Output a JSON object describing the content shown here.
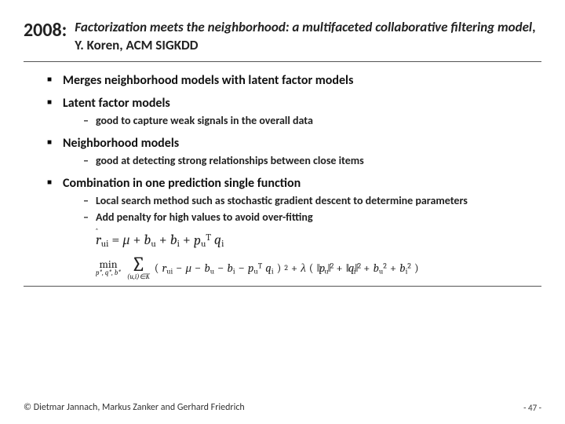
{
  "header": {
    "year": "2008:",
    "title_italic": "Factorization meets the neighborhood: a multifaceted collaborative filtering model",
    "title_rest": ", Y. Koren, ACM SIGKDD"
  },
  "bullets": {
    "b1": "Merges neighborhood models with latent factor models",
    "b2": "Latent factor models",
    "b2_sub1": "good to capture weak signals in the overall data",
    "b3": "Neighborhood models",
    "b3_sub1": "good at detecting strong relationships between close items",
    "b4": "Combination in one prediction single function",
    "b4_sub1": "Local search method such as stochastic gradient descent to determine parameters",
    "b4_sub2": "Add penalty for high values to avoid over-fitting"
  },
  "formula": {
    "lhs_var": "r",
    "lhs_sub": "ui",
    "mu": "μ",
    "plus": "+",
    "eq": "=",
    "bu_b": "b",
    "bu_sub": "u",
    "bi_b": "b",
    "bi_sub": "i",
    "pu_p": "p",
    "pu_sub": "u",
    "pu_sup": "T",
    "qi_q": "q",
    "qi_sub": "i",
    "min": "min",
    "min_sub": "p*, q*, b*",
    "sum_lim": "(u,i)∈K",
    "open_paren": "(",
    "close_paren": ")",
    "minus": "−",
    "sq": "2",
    "lambda": "λ",
    "norm_open": "‖",
    "norm_close": "‖"
  },
  "footer": {
    "credit": "© Dietmar Jannach, Markus Zanker and Gerhard Friedrich",
    "page": "- 47 -"
  }
}
